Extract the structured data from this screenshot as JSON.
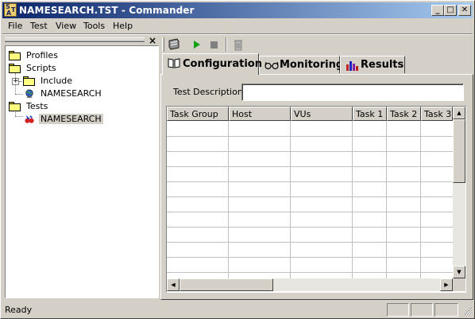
{
  "window": {
    "title": "NAMESEARCH.TST - Commander",
    "minimize": "_",
    "maximize": "□",
    "close": "✕",
    "icon_letters": [
      "S",
      "T",
      "A"
    ]
  },
  "menu": {
    "file": "File",
    "test": "Test",
    "view": "View",
    "tools": "Tools",
    "help": "Help"
  },
  "left_pane": {
    "close": "×",
    "tree": {
      "profiles": "Profiles",
      "scripts": "Scripts",
      "include": "Include",
      "script_namesearch": "NAMESEARCH",
      "tests": "Tests",
      "test_namesearch": "NAMESEARCH",
      "expander": "+"
    }
  },
  "toolbar": {
    "icons": [
      "save-icon",
      "run-icon",
      "stop-icon",
      "delete-icon"
    ]
  },
  "tabs": {
    "configuration": "Configuration",
    "monitoring": "Monitoring",
    "results": "Results"
  },
  "config": {
    "description_label": "Test Description",
    "description_value": "",
    "columns": [
      "Task Group",
      "Host",
      "VUs",
      "Task 1",
      "Task 2",
      "Task 3"
    ]
  },
  "scrollbar": {
    "up": "▲",
    "down": "▼",
    "left": "◀",
    "right": "▶"
  },
  "status": {
    "text": "Ready"
  },
  "colors": {
    "title_start": "#0a246a",
    "title_end": "#a6caf0",
    "face": "#d4d0c8"
  }
}
